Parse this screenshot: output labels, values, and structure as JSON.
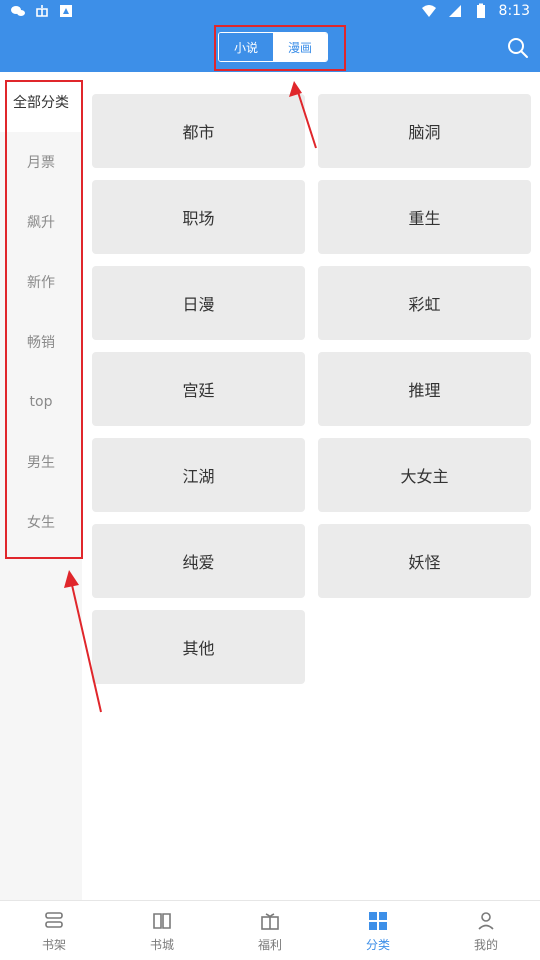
{
  "status_bar": {
    "time": "8:13",
    "left_icons": [
      "wechat-icon",
      "bug-icon",
      "notification-icon"
    ],
    "right_icons": [
      "wifi-icon",
      "cellular-icon",
      "battery-icon"
    ]
  },
  "header": {
    "tabs": [
      {
        "label": "小说",
        "active": true
      },
      {
        "label": "漫画",
        "active": false
      }
    ],
    "search_icon": "search-icon"
  },
  "sidebar": {
    "items": [
      {
        "label": "全部分类",
        "active": true
      },
      {
        "label": "月票",
        "active": false
      },
      {
        "label": "飙升",
        "active": false
      },
      {
        "label": "新作",
        "active": false
      },
      {
        "label": "畅销",
        "active": false
      },
      {
        "label": "top",
        "active": false
      },
      {
        "label": "男生",
        "active": false
      },
      {
        "label": "女生",
        "active": false
      }
    ]
  },
  "categories": [
    "都市",
    "脑洞",
    "职场",
    "重生",
    "日漫",
    "彩虹",
    "宫廷",
    "推理",
    "江湖",
    "大女主",
    "纯爱",
    "妖怪",
    "其他"
  ],
  "bottom_nav": {
    "tabs": [
      {
        "label": "书架",
        "icon": "bookshelf-icon",
        "active": false
      },
      {
        "label": "书城",
        "icon": "book-icon",
        "active": false
      },
      {
        "label": "福利",
        "icon": "gift-icon",
        "active": false
      },
      {
        "label": "分类",
        "icon": "grid-icon",
        "active": true
      },
      {
        "label": "我的",
        "icon": "user-icon",
        "active": false
      }
    ]
  },
  "colors": {
    "primary": "#3d8fe8",
    "annotation": "#e0262b",
    "tile": "#ebebeb"
  }
}
